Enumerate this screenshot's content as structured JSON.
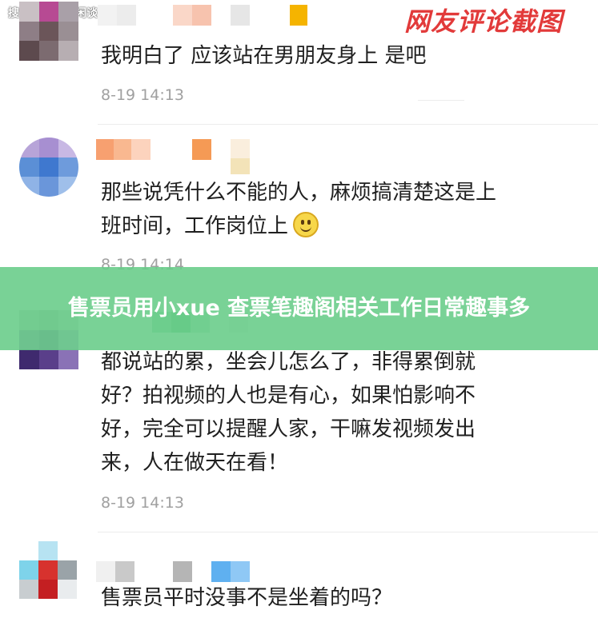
{
  "watermark": "搜狐号@阿尔闲谈",
  "stamp": "网友评论截图",
  "banner": {
    "title": "售票员用小xue 查票笔趣阁相关工作日常趣事多"
  },
  "comments": [
    {
      "text_lines": [
        "我明白了 应该站在男朋友身上 是吧"
      ],
      "time": "8-19 14:13"
    },
    {
      "text_lines": [
        "那些说凭什么不能的人，麻烦搞清楚这是上",
        "班时间，工作岗位上"
      ],
      "time": "8-19 14:14",
      "emoji": "smiley-icon"
    },
    {
      "text_lines": [
        "都说站的累，坐会儿怎么了，非得累倒就",
        "好？拍视频的人也是有心，如果怕影响不",
        "好，完全可以提醒人家，干嘛发视频发出",
        "来，人在做天在看！"
      ],
      "time": "8-19 14:13"
    },
    {
      "text_lines": [
        "售票员平时没事不是坐着的吗？"
      ],
      "time": ""
    }
  ],
  "colors": {
    "banner_bg": "#66cc88",
    "stamp_red": "#e23a3a",
    "time_gray": "#a0a0a0"
  }
}
